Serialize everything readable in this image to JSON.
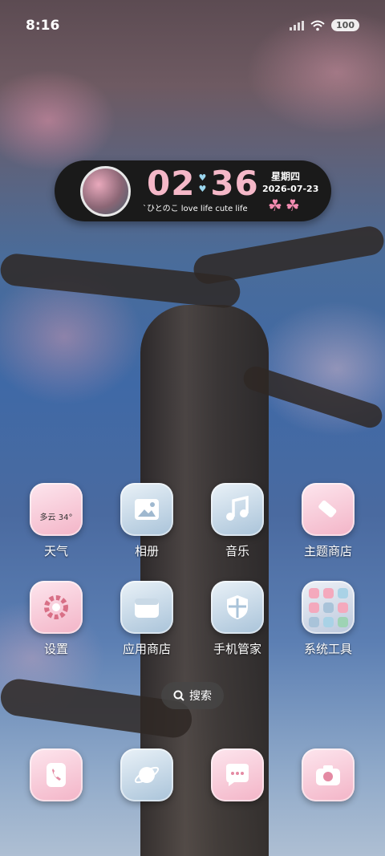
{
  "status_bar": {
    "time": "8:16",
    "battery": "100"
  },
  "widget": {
    "hour": "02",
    "minute": "36",
    "weekday": "星期四",
    "date": "2026-07-23",
    "slogan": "`ひとのこ love life cute life",
    "clovers": "☘☘"
  },
  "apps": {
    "weather": {
      "label": "天气",
      "badge": "多云 34°"
    },
    "gallery": {
      "label": "相册"
    },
    "music": {
      "label": "音乐"
    },
    "themes": {
      "label": "主题商店"
    },
    "settings": {
      "label": "设置"
    },
    "app_store": {
      "label": "应用商店"
    },
    "phone_manager": {
      "label": "手机管家"
    },
    "system_tools": {
      "label": "系统工具"
    }
  },
  "search": {
    "label": "搜索"
  },
  "colors": {
    "widget_bg": "#1a1a1a",
    "clock_pink": "#f5b8c8",
    "heart_blue": "#9ad6ee"
  }
}
